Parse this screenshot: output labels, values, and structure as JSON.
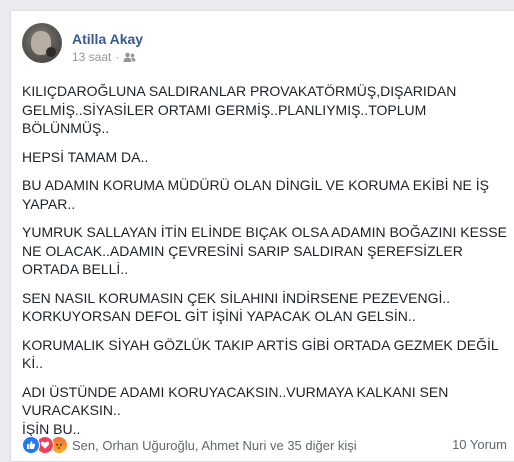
{
  "post": {
    "author": "Atilla Akay",
    "timestamp": "13 saat",
    "separator": "·",
    "privacy_icon": "friends-icon",
    "paragraphs": [
      "KILIÇDAROĞLUNA SALDIRANLAR PROVAKATÖRMÜŞ,DIŞARIDAN\nGELMİŞ..SİYASİLER ORTAMI GERMİŞ..PLANLIYMIŞ..TOPLUM\nBÖLÜNMÜŞ..",
      "HEPSİ TAMAM DA..",
      "BU ADAMIN KORUMA MÜDÜRÜ OLAN DİNGİL VE KORUMA EKİBİ NE İŞ\nYAPAR..",
      "YUMRUK SALLAYAN İTİN ELİNDE BIÇAK OLSA ADAMIN BOĞAZINI KESSE\nNE OLACAK..ADAMIN ÇEVRESİNİ SARIP SALDIRAN ŞEREFSİZLER\nORTADA BELLİ..",
      "SEN NASIL KORUMASIN ÇEK SİLAHINI İNDİRSENE PEZEVENGİ..\nKORKUYORSAN DEFOL GİT İŞİNİ YAPACAK OLAN GELSİN..",
      "KORUMALIK SİYAH GÖZLÜK TAKIP ARTİS GİBİ ORTADA GEZMEK DEĞİL\nKİ..",
      "ADI ÜSTÜNDE ADAMI KORUYACAKSIN..VURMAYA KALKANI SEN\nVURACAKSIN..\nİŞİN BU.."
    ]
  },
  "footer": {
    "reaction_icons": [
      "like-icon",
      "love-icon",
      "angry-icon"
    ],
    "reactors_text": "Sen, Orhan Uğuroğlu, Ahmet Nuri ve 35 diğer kişi",
    "comments_text": "10 Yorum"
  },
  "colors": {
    "name_link": "#385898",
    "body_text": "#1d2129",
    "meta_text": "#90949c",
    "like_blue": "#2078f4",
    "love_red": "#f33e58"
  }
}
